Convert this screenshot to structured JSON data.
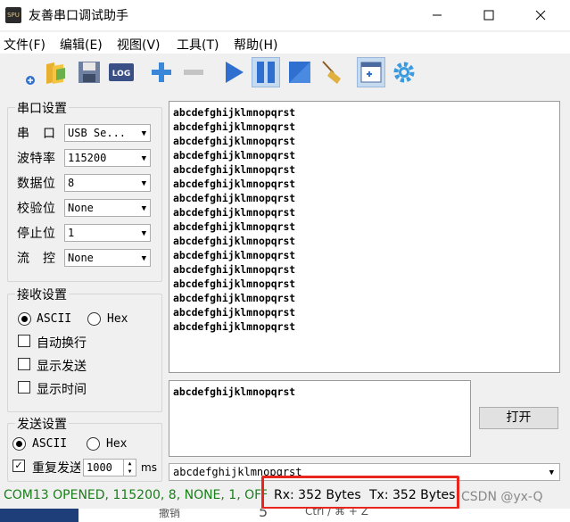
{
  "window": {
    "title": "友善串口调试助手",
    "icon_text": "SPU",
    "controls": [
      "minimize-icon",
      "maximize-icon",
      "close-icon"
    ]
  },
  "menu": [
    "文件(F)",
    "编辑(E)",
    "视图(V)",
    "工具(T)",
    "帮助(H)"
  ],
  "toolbar": {
    "icons": [
      "new-icon",
      "open-folder-icon",
      "save-icon",
      "log-icon",
      "add-icon",
      "remove-icon",
      "play-icon",
      "pause-icon",
      "stop-icon",
      "clear-broom-icon",
      "new-window-icon",
      "settings-gear-icon"
    ],
    "log_label": "LOG"
  },
  "serial_settings": {
    "title": "串口设置",
    "port": {
      "label": "串　口",
      "value": "USB Se..."
    },
    "baud": {
      "label": "波特率",
      "value": "115200"
    },
    "data_bits": {
      "label": "数据位",
      "value": "8"
    },
    "parity": {
      "label": "校验位",
      "value": "None"
    },
    "stop_bits": {
      "label": "停止位",
      "value": "1"
    },
    "flow": {
      "label": "流　控",
      "value": "None"
    }
  },
  "receive_settings": {
    "title": "接收设置",
    "ascii_label": "ASCII",
    "hex_label": "Hex",
    "mode": "ASCII",
    "auto_wrap": {
      "label": "自动换行",
      "checked": false
    },
    "show_send": {
      "label": "显示发送",
      "checked": false
    },
    "show_time": {
      "label": "显示时间",
      "checked": false
    }
  },
  "send_settings": {
    "title": "发送设置",
    "ascii_label": "ASCII",
    "hex_label": "Hex",
    "mode": "ASCII",
    "repeat": {
      "label": "重复发送",
      "checked": true
    },
    "interval": "1000",
    "unit": "ms"
  },
  "receive_area": {
    "lines": [
      "abcdefghijklmnopqrst",
      "abcdefghijklmnopqrst",
      "abcdefghijklmnopqrst",
      "abcdefghijklmnopqrst",
      "abcdefghijklmnopqrst",
      "abcdefghijklmnopqrst",
      "abcdefghijklmnopqrst",
      "abcdefghijklmnopqrst",
      "abcdefghijklmnopqrst",
      "abcdefghijklmnopqrst",
      "abcdefghijklmnopqrst",
      "abcdefghijklmnopqrst",
      "abcdefghijklmnopqrst",
      "abcdefghijklmnopqrst",
      "abcdefghijklmnopqrst",
      "abcdefghijklmnopqrst"
    ]
  },
  "send_area": {
    "text": "abcdefghijklmnopqrst"
  },
  "open_button": "打开",
  "history": {
    "value": "abcdefghijklmnopqrst"
  },
  "status": {
    "port_info": "COM13 OPENED, 115200, 8, NONE, 1, OFF",
    "rx": "Rx: 352 Bytes",
    "tx": "Tx: 352 Bytes"
  },
  "watermark": "CSDN @yx-Q",
  "background_window": {
    "undo": "撤销",
    "number": "5",
    "shortcut": "Ctrl / ⌘ + Z"
  },
  "colors": {
    "accent_blue": "#2f6fd0",
    "status_green": "#1a7f1a",
    "highlight_red": "#e8261d"
  }
}
